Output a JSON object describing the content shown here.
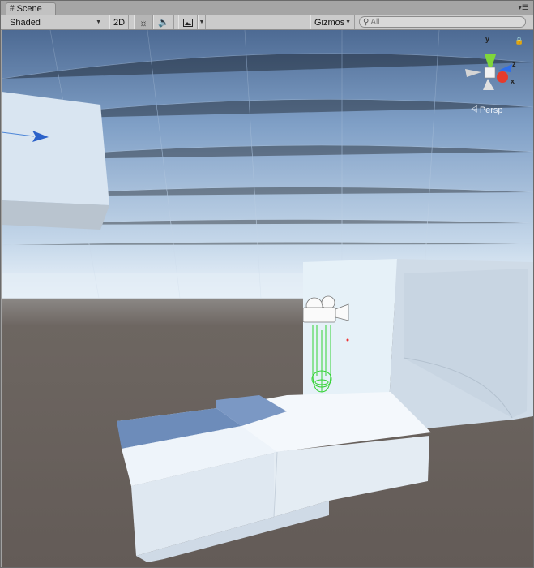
{
  "window": {
    "tab_label": "Scene",
    "tab_icon": "grid-icon",
    "menu_icon": "panel-menu-icon"
  },
  "toolbar": {
    "shading_mode": "Shaded",
    "mode_2d_label": "2D",
    "lighting_icon": "sun-icon",
    "audio_icon": "speaker-icon",
    "effects_icon": "image-icon",
    "gizmos_label": "Gizmos",
    "search_placeholder": "All"
  },
  "gizmo": {
    "x_label": "x",
    "y_label": "y",
    "z_label": "z",
    "projection_label": "Persp",
    "colors": {
      "x": "#e53b2d",
      "y": "#7fd63a",
      "z": "#2f6ee8"
    }
  },
  "scene": {
    "sky_top": "#4f6c94",
    "sky_horizon": "#d8e7f4",
    "ground": "#6b6460",
    "geometry_color": "#dde9f5",
    "collider_color": "#33d233"
  }
}
